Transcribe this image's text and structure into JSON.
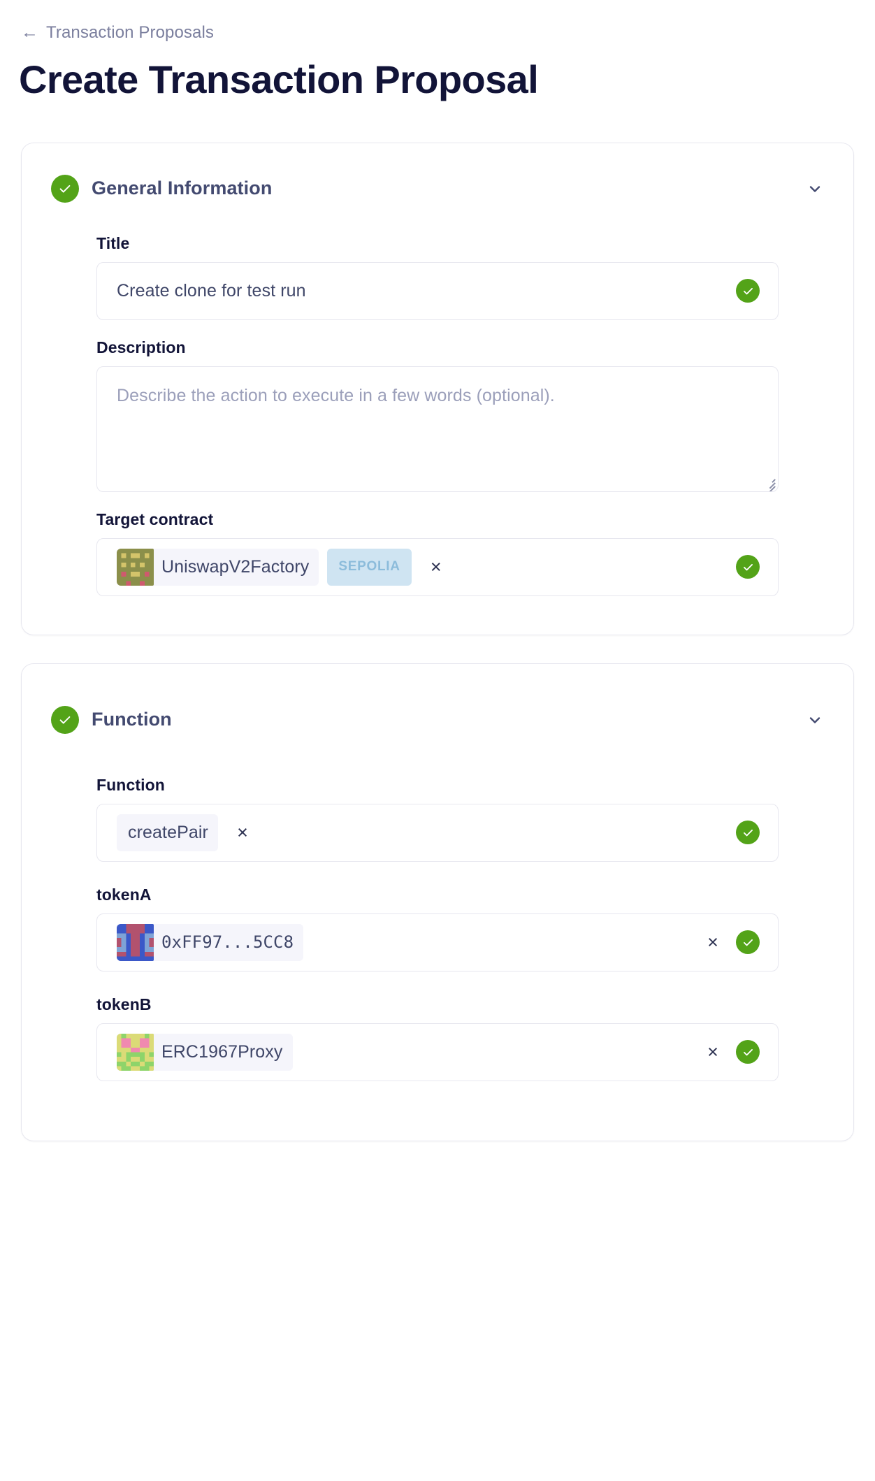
{
  "breadcrumb": {
    "back_icon": "arrow-left-icon",
    "label": "Transaction Proposals"
  },
  "page_title": "Create Transaction Proposal",
  "colors": {
    "accent_green": "#53a318",
    "title_navy": "#121438",
    "muted_text": "#7b7f9e",
    "card_border": "#e7e7ef",
    "chip_bg": "#f5f5fb",
    "badge_bg": "#cfe4f2",
    "badge_text": "#8cbcdb"
  },
  "sections": [
    {
      "id": "general-information",
      "title": "General Information",
      "status_icon": "check-circle-icon",
      "toggle_icon": "chevron-down-icon",
      "fields": {
        "title": {
          "label": "Title",
          "value": "Create clone for test run",
          "placeholder": "",
          "valid_icon": "check-circle-icon"
        },
        "description": {
          "label": "Description",
          "value": "",
          "placeholder": "Describe the action to execute in a few words (optional).",
          "resize_handle": "resize-grip-icon"
        },
        "target_contract": {
          "label": "Target contract",
          "chip_label": "UniswapV2Factory",
          "chip_avatar": "identicon-olive",
          "network_badge": "SEPOLIA",
          "remove_icon": "close-icon",
          "remove_label": "×",
          "valid_icon": "check-circle-icon"
        }
      }
    },
    {
      "id": "function",
      "title": "Function",
      "status_icon": "check-circle-icon",
      "toggle_icon": "chevron-down-icon",
      "fields": {
        "function": {
          "label": "Function",
          "chip_label": "createPair",
          "remove_label": "×",
          "remove_icon": "close-icon",
          "valid_icon": "check-circle-icon"
        },
        "tokenA": {
          "label": "tokenA",
          "chip_label": "0xFF97...5CC8",
          "chip_avatar": "identicon-blue-red",
          "remove_label": "×",
          "remove_icon": "close-icon",
          "valid_icon": "check-circle-icon"
        },
        "tokenB": {
          "label": "tokenB",
          "chip_label": "ERC1967Proxy",
          "chip_avatar": "identicon-green-pink",
          "remove_label": "×",
          "remove_icon": "close-icon",
          "valid_icon": "check-circle-icon"
        }
      }
    }
  ]
}
